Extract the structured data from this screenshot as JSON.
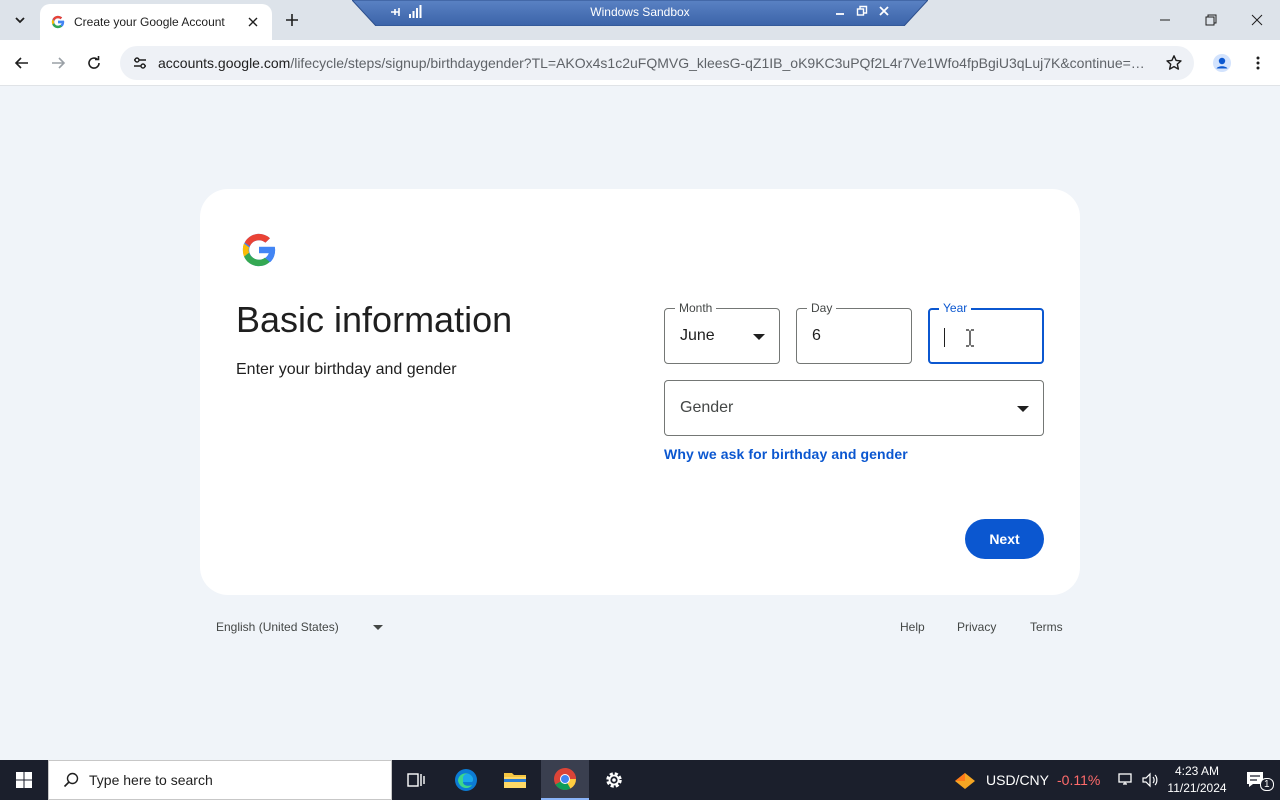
{
  "browser": {
    "tab_title": "Create your Google Account",
    "url_host": "accounts.google.com",
    "url_path": "/lifecycle/steps/signup/birthdaygender?TL=AKOx4s1c2uFQMVG_kleesG-qZ1IB_oK9KC3uPQf2L4r7Ve1Wfo4fpBgiU3qLuj7K&continue=http..."
  },
  "sandbox": {
    "title": "Windows Sandbox"
  },
  "form": {
    "title": "Basic information",
    "subtitle": "Enter your birthday and gender",
    "month_label": "Month",
    "month_value": "June",
    "day_label": "Day",
    "day_value": "6",
    "year_label": "Year",
    "year_value": "",
    "gender_placeholder": "Gender",
    "why_link": "Why we ask for birthday and gender",
    "next_label": "Next"
  },
  "footer": {
    "language": "English (United States)",
    "help": "Help",
    "privacy": "Privacy",
    "terms": "Terms"
  },
  "taskbar": {
    "search_placeholder": "Type here to search",
    "currency": "USD/CNY",
    "change": "-0.11%",
    "time": "4:23 AM",
    "date": "11/21/2024",
    "notification_count": "1"
  },
  "colors": {
    "accent": "#0b57d0",
    "page_bg": "#f0f4f9",
    "tabstrip_bg": "#dde3ea"
  }
}
